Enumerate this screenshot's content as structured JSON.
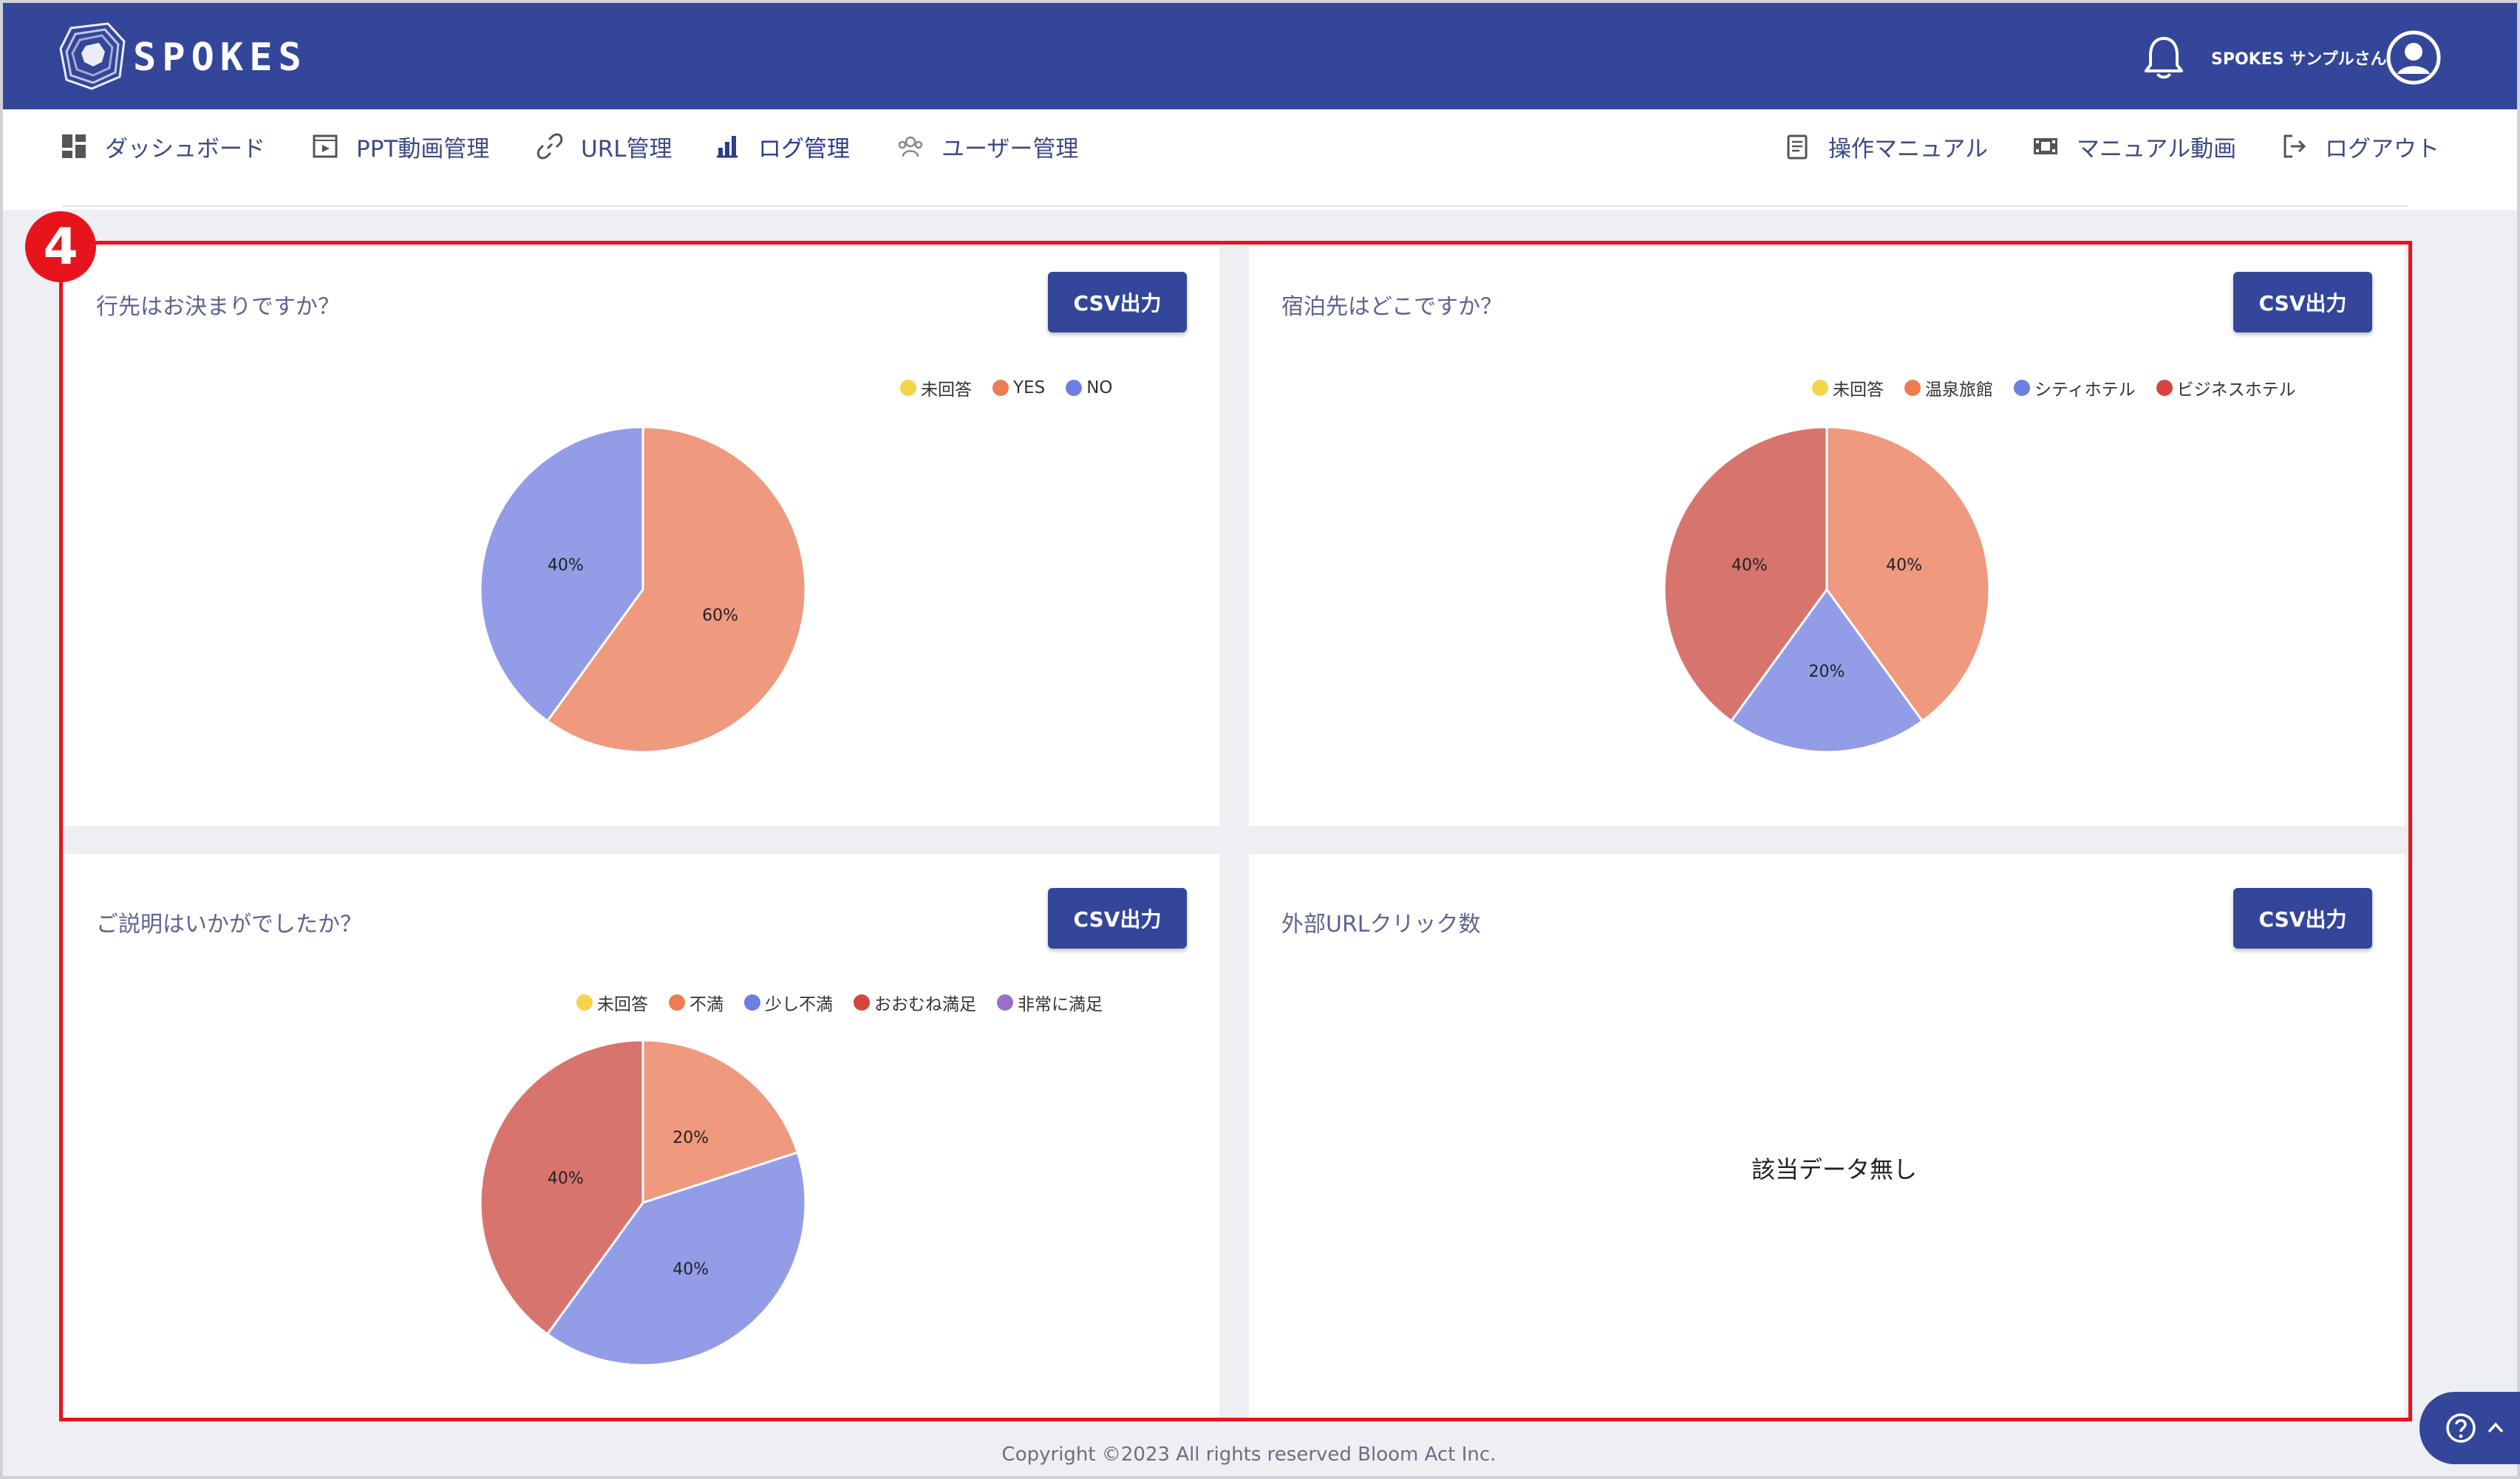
{
  "header": {
    "logo_text": "SPOKES",
    "user_name": "SPOKES サンプルさん"
  },
  "nav": {
    "left": [
      {
        "label": "ダッシュボード",
        "icon": "dashboard-icon"
      },
      {
        "label": "PPT動画管理",
        "icon": "video-icon"
      },
      {
        "label": "URL管理",
        "icon": "link-icon"
      },
      {
        "label": "ログ管理",
        "icon": "log-icon"
      },
      {
        "label": "ユーザー管理",
        "icon": "users-icon"
      }
    ],
    "right": [
      {
        "label": "操作マニュアル",
        "icon": "document-icon"
      },
      {
        "label": "マニュアル動画",
        "icon": "film-icon"
      },
      {
        "label": "ログアウト",
        "icon": "logout-icon"
      }
    ]
  },
  "annotation_badge": "4",
  "panels": [
    {
      "title": "行先はお決まりですか？",
      "button": "CSV出力"
    },
    {
      "title": "宿泊先はどこですか？",
      "button": "CSV出力"
    },
    {
      "title": "ご説明はいかがでしたか？",
      "button": "CSV出力"
    },
    {
      "title": "外部URLクリック数",
      "button": "CSV出力",
      "empty_text": "該当データ無し"
    }
  ],
  "chart_data": [
    {
      "type": "pie",
      "legend": [
        "未回答",
        "YES",
        "NO"
      ],
      "legend_colors": [
        "#f6d44a",
        "#ee7b52",
        "#6e7fe0"
      ],
      "slices": [
        {
          "name": "YES",
          "value": 60,
          "label": "60%",
          "color": "#ef997f"
        },
        {
          "name": "NO",
          "value": 40,
          "label": "40%",
          "color": "#939ce6"
        }
      ]
    },
    {
      "type": "pie",
      "legend": [
        "未回答",
        "温泉旅館",
        "シティホテル",
        "ビジネスホテル"
      ],
      "legend_colors": [
        "#f6d44a",
        "#ee7b52",
        "#6e7fe0",
        "#d7443e"
      ],
      "slices": [
        {
          "name": "温泉旅館",
          "value": 40,
          "label": "40%",
          "color": "#ef997f"
        },
        {
          "name": "シティホテル",
          "value": 20,
          "label": "20%",
          "color": "#939ce6"
        },
        {
          "name": "ビジネスホテル",
          "value": 40,
          "label": "40%",
          "color": "#d8746e"
        }
      ]
    },
    {
      "type": "pie",
      "legend": [
        "未回答",
        "不満",
        "少し不満",
        "おおむね満足",
        "非常に満足"
      ],
      "legend_colors": [
        "#f6d44a",
        "#ee7b52",
        "#6e7fe0",
        "#d7443e",
        "#9a6fc6"
      ],
      "slices": [
        {
          "name": "不満",
          "value": 20,
          "label": "20%",
          "color": "#ef997f"
        },
        {
          "name": "少し不満",
          "value": 40,
          "label": "40%",
          "color": "#939ce6"
        },
        {
          "name": "おおむね満足",
          "value": 40,
          "label": "40%",
          "color": "#d8746e"
        }
      ]
    }
  ],
  "footer": {
    "copyright": "Copyright ©2023 All rights reserved Bloom Act Inc."
  }
}
